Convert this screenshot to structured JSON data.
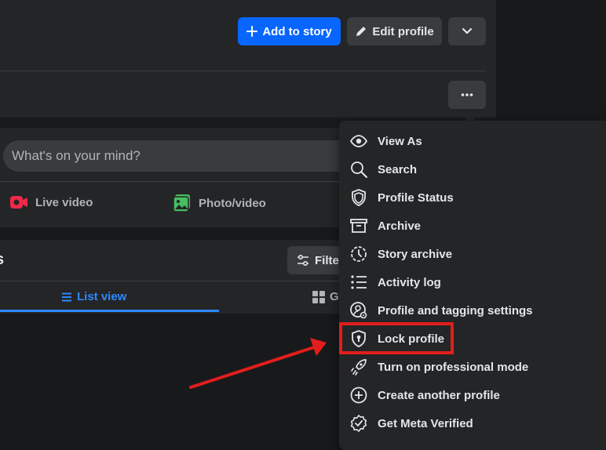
{
  "profile_header": {
    "add_to_story_label": "Add to story",
    "edit_profile_label": "Edit profile"
  },
  "composer": {
    "placeholder": "What's on your mind?",
    "actions": [
      {
        "label": "Live video",
        "icon": "live-video-icon",
        "color": "#f02849"
      },
      {
        "label": "Photo/video",
        "icon": "photo-video-icon",
        "color": "#45bd62"
      }
    ]
  },
  "posts": {
    "title": "s",
    "filters_label": "Filter",
    "tabs": [
      {
        "label": "List view",
        "icon": "list-icon",
        "active": true
      },
      {
        "label": "Gr",
        "icon": "grid-icon",
        "active": false
      }
    ]
  },
  "menu": {
    "items": [
      {
        "label": "View As",
        "icon": "eye-icon"
      },
      {
        "label": "Search",
        "icon": "search-icon"
      },
      {
        "label": "Profile Status",
        "icon": "shield-icon"
      },
      {
        "label": "Archive",
        "icon": "archive-box-icon"
      },
      {
        "label": "Story archive",
        "icon": "story-clock-icon"
      },
      {
        "label": "Activity log",
        "icon": "list-icon"
      },
      {
        "label": "Profile and tagging settings",
        "icon": "person-gear-icon"
      },
      {
        "label": "Lock profile",
        "icon": "lock-shield-icon",
        "highlighted": true
      },
      {
        "label": "Turn on professional mode",
        "icon": "rocket-icon"
      },
      {
        "label": "Create another profile",
        "icon": "plus-circle-icon"
      },
      {
        "label": "Get Meta Verified",
        "icon": "verified-badge-icon"
      }
    ]
  },
  "colors": {
    "accent": "#0866ff",
    "link_blue": "#2d88ff",
    "annotation_red": "#e31d1d",
    "surface": "#242526",
    "background": "#18191a"
  }
}
